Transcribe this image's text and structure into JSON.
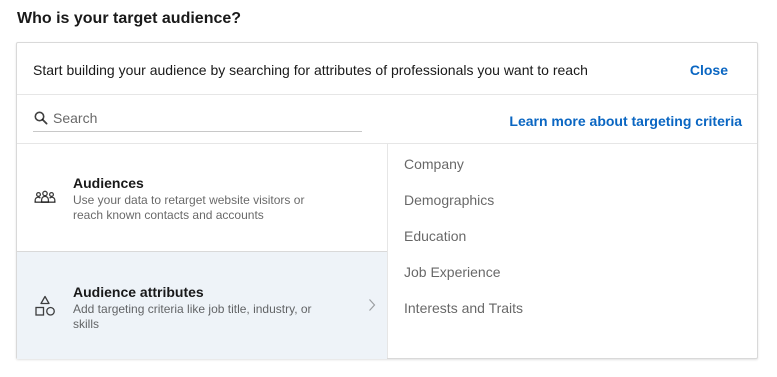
{
  "page": {
    "title": "Who is your target audience?"
  },
  "intro": {
    "text": "Start building your audience by searching for attributes of professionals you want to reach",
    "close_label": "Close"
  },
  "search": {
    "placeholder": "Search",
    "value": "",
    "learn_more_label": "Learn more about targeting criteria"
  },
  "options": [
    {
      "title": "Audiences",
      "description": "Use your data to retarget website visitors or reach known contacts and accounts",
      "icon": "people-group-icon",
      "selected": false
    },
    {
      "title": "Audience attributes",
      "description": "Add targeting criteria like job title, industry, or skills",
      "icon": "shapes-icon",
      "selected": true
    }
  ],
  "categories": [
    "Company",
    "Demographics",
    "Education",
    "Job Experience",
    "Interests and Traits"
  ],
  "colors": {
    "link": "#0a66c2",
    "selected_background": "#eef3f8",
    "border": "#d9d9d9"
  }
}
